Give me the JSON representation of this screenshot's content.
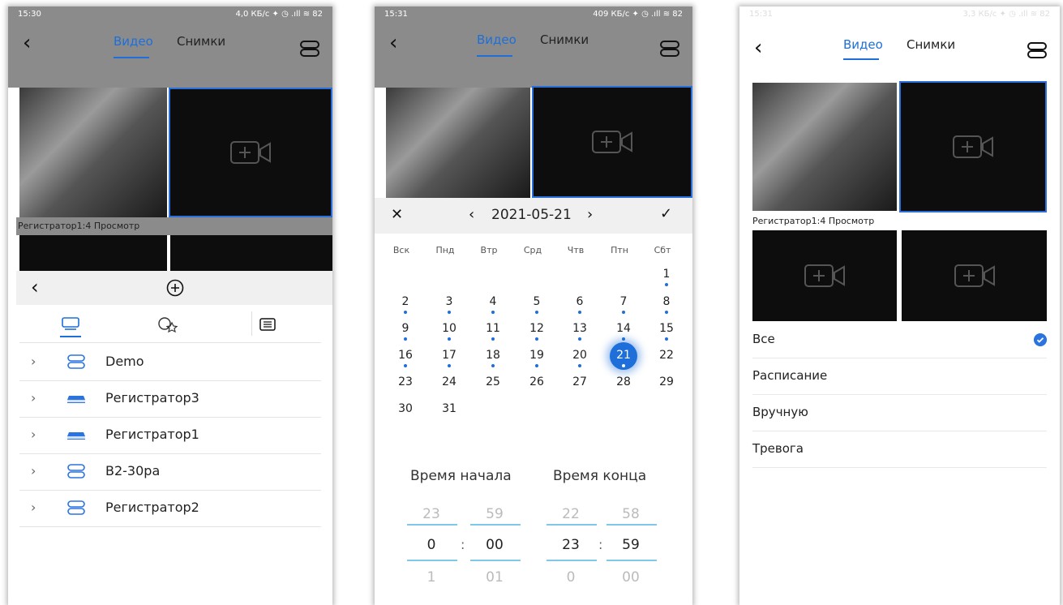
{
  "phone1": {
    "status": {
      "time": "15:30",
      "right": "4,0 КБ/с ✦ ◷ .ıll ≋ 82"
    },
    "tabs": {
      "video": "Видео",
      "snapshots": "Снимки"
    },
    "caption": "Регистратор1:4  Просмотр",
    "devices": [
      {
        "label": "Demo",
        "icon": "server-icon"
      },
      {
        "label": "Регистратор3",
        "icon": "dvr-icon"
      },
      {
        "label": "Регистратор1",
        "icon": "dvr-icon"
      },
      {
        "label": "B2-30pa",
        "icon": "server-icon"
      },
      {
        "label": "Регистратор2",
        "icon": "server-icon"
      }
    ]
  },
  "phone2": {
    "status": {
      "time": "15:31",
      "right": "409 КБ/с ✦ ◷ .ıll ≋ 82"
    },
    "tabs": {
      "video": "Видео",
      "snapshots": "Снимки"
    },
    "calendar": {
      "date": "2021-05-21",
      "weekdays": [
        "Вск",
        "Пнд",
        "Втр",
        "Срд",
        "Чтв",
        "Птн",
        "Сбт"
      ],
      "selected_day": 21,
      "days_with_records": [
        1,
        2,
        3,
        4,
        5,
        6,
        7,
        8,
        9,
        10,
        11,
        12,
        13,
        14,
        15,
        16,
        17,
        18,
        19,
        20,
        21
      ]
    },
    "time_picker": {
      "start_label": "Время начала",
      "end_label": "Время конца",
      "start": {
        "prev_h": "23",
        "prev_m": "59",
        "h": "0",
        "m": "00",
        "next_h": "1",
        "next_m": "01"
      },
      "end": {
        "prev_h": "22",
        "prev_m": "58",
        "h": "23",
        "m": "59",
        "next_h": "0",
        "next_m": "00"
      },
      "separator": ":"
    }
  },
  "phone3": {
    "status": {
      "time": "15:31",
      "right": "3,3 КБ/с ✦ ◷ .ıll ≋ 82"
    },
    "tabs": {
      "video": "Видео",
      "snapshots": "Снимки"
    },
    "caption": "Регистратор1:4  Просмотр",
    "filters": [
      {
        "label": "Все",
        "checked": true
      },
      {
        "label": "Расписание",
        "checked": false
      },
      {
        "label": "Вручную",
        "checked": false
      },
      {
        "label": "Тревога",
        "checked": false
      }
    ]
  },
  "colors": {
    "accent": "#1e6fd9",
    "bar_gray": "#8b8b8b",
    "tile": "#0d0d0d"
  }
}
